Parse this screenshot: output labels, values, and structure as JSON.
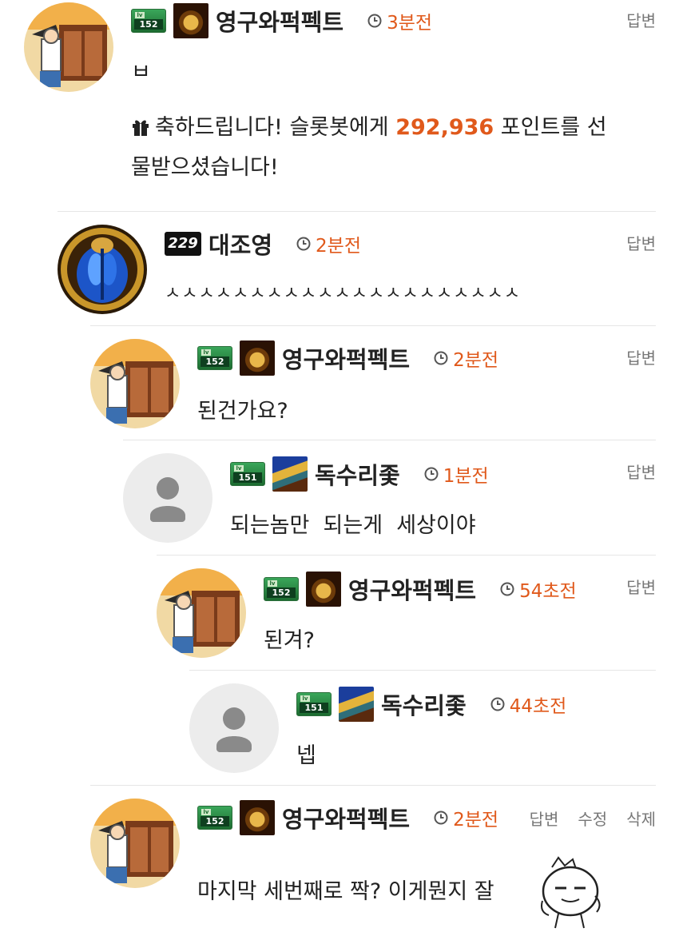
{
  "colors": {
    "accent": "#e0591b",
    "divider": "#e6e6e6",
    "meta": "#777777"
  },
  "comments": [
    {
      "avatar": "egypt-door",
      "level": "152",
      "badge": "gold",
      "nick": "영구와퍽펙트",
      "time": "3분전",
      "actions": [
        "답변"
      ],
      "text": "ㅂ",
      "gift": {
        "prefix": "축하드립니다! 슬롯봇에게 ",
        "points": "292,936",
        "suffix": " 포인트를 선",
        "line2": "물받으셨습니다!"
      }
    },
    {
      "avatar": "scarab",
      "level": "229",
      "nick": "대조영",
      "time": "2분전",
      "actions": [
        "답변"
      ],
      "text": "ㅅㅅㅅㅅㅅㅅㅅㅅㅅㅅㅅㅅㅅㅅㅅㅅㅅㅅㅅㅅㅅ"
    },
    {
      "avatar": "egypt-door",
      "level": "152",
      "badge": "gold",
      "nick": "영구와퍽펙트",
      "time": "2분전",
      "actions": [
        "답변"
      ],
      "text": "된건가요?"
    },
    {
      "avatar": "default",
      "level": "151",
      "badge": "blue",
      "nick": "독수리좇",
      "time": "1분전",
      "actions": [
        "답변"
      ],
      "text": "되는놈만  되는게  세상이야"
    },
    {
      "avatar": "egypt-door",
      "level": "152",
      "badge": "gold",
      "nick": "영구와퍽펙트",
      "time": "54초전",
      "actions": [
        "답변"
      ],
      "text": "된겨?"
    },
    {
      "avatar": "default",
      "level": "151",
      "badge": "blue",
      "nick": "독수리좇",
      "time": "44초전",
      "actions": [],
      "text": "넵"
    },
    {
      "avatar": "egypt-door",
      "level": "152",
      "badge": "gold",
      "nick": "영구와퍽펙트",
      "time": "2분전",
      "actions": [
        "답변",
        "수정",
        "삭제"
      ],
      "text": "마지막 세번째로 짝? 이게뭔지 잘"
    }
  ]
}
